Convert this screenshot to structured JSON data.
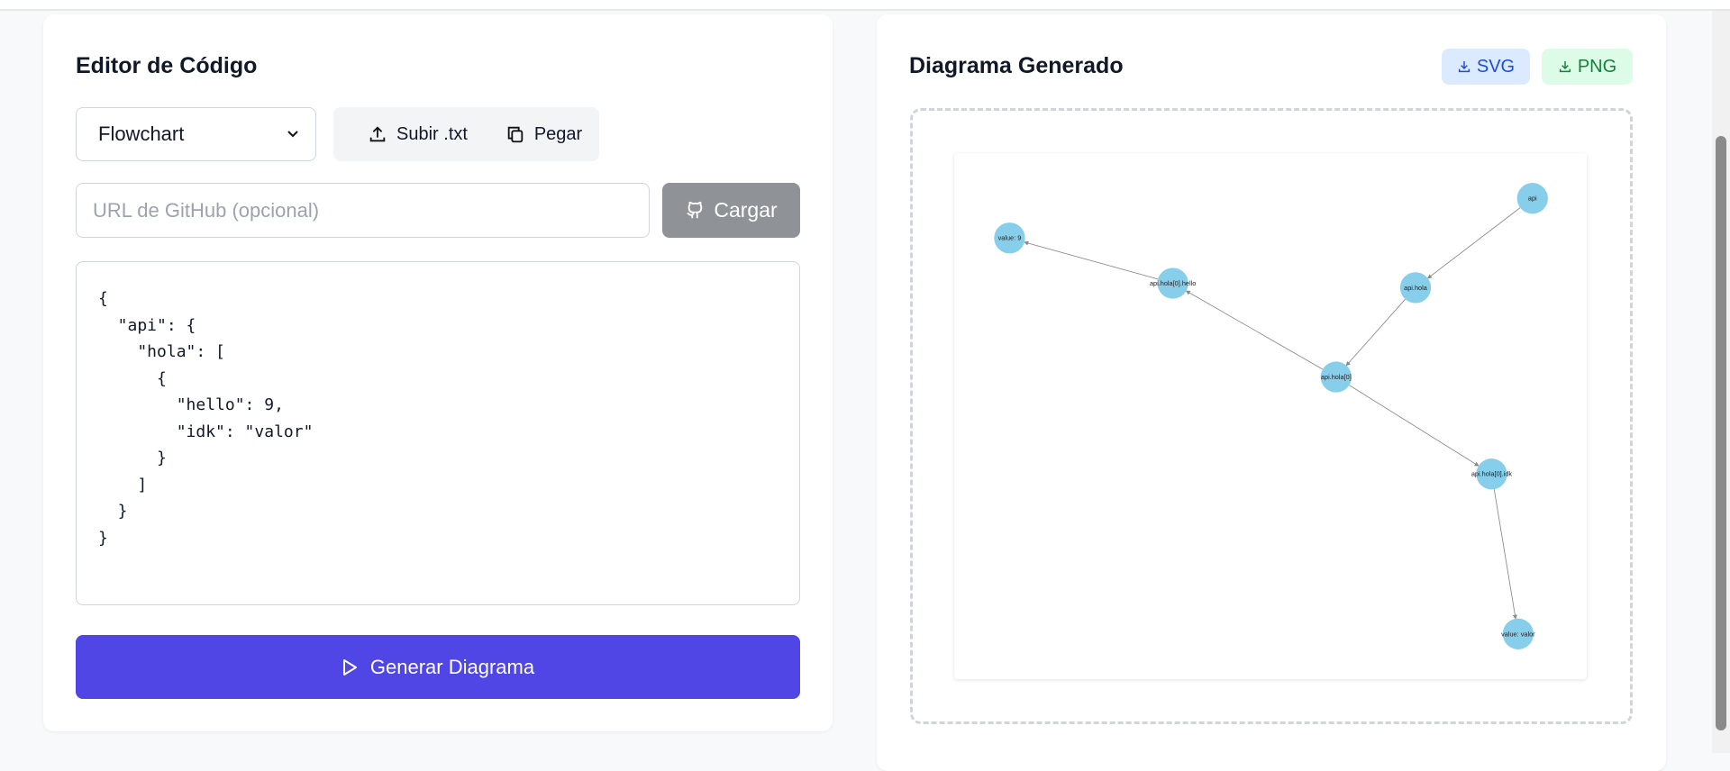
{
  "editor": {
    "title": "Editor de Código",
    "diagram_type": "Flowchart",
    "upload_label": "Subir .txt",
    "paste_label": "Pegar",
    "github_placeholder": "URL de GitHub (opcional)",
    "load_label": "Cargar",
    "code": "{\n  \"api\": {\n    \"hola\": [\n      {\n        \"hello\": 9,\n        \"idk\": \"valor\"\n      }\n    ]\n  }\n}",
    "generate_label": "Generar Diagrama"
  },
  "diagram": {
    "title": "Diagrama Generado",
    "svg_label": "SVG",
    "png_label": "PNG",
    "node_color": "#87ceeb",
    "nodes": [
      "api",
      "api.hola",
      "api.hola[0]",
      "api.hola[0].hello",
      "value: 9",
      "api.hola[0].idk",
      "value: valor"
    ],
    "edges": [
      [
        "api",
        "api.hola"
      ],
      [
        "api.hola",
        "api.hola[0]"
      ],
      [
        "api.hola[0]",
        "api.hola[0].hello"
      ],
      [
        "api.hola[0].hello",
        "value: 9"
      ],
      [
        "api.hola[0]",
        "api.hola[0].idk"
      ],
      [
        "api.hola[0].idk",
        "value: valor"
      ]
    ]
  }
}
